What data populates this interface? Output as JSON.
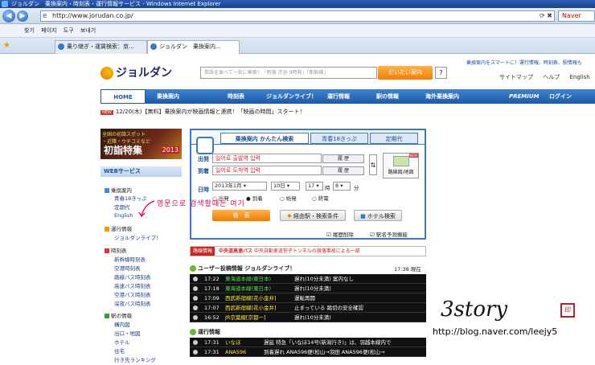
{
  "window": {
    "title": "ジョルダン　乗換案内・時刻表・運行情報サービス - Windows Internet Explorer"
  },
  "address": {
    "url": "http://www.jorudan.co.jp/",
    "search_text": "Naver"
  },
  "menubar": {
    "items": [
      "찾기",
      "페이지",
      "도구",
      "보내기"
    ]
  },
  "tabs": [
    {
      "label": "乗り継ぎ・運賃検索：京..."
    },
    {
      "label": "ジョルダン　乗換案内..."
    }
  ],
  "site": {
    "logo": "ジョルダン",
    "search_placeholder": "単語を並べて一気に検索！「新宿 渋谷 9時発」「新幹線」",
    "search_button": "だいたい案内",
    "help": "?",
    "tagline": "乗換案内をスマートに！運行情報、時刻表、駅情報も",
    "toplinks": [
      "サイトマップ",
      "ヘルプ",
      "English"
    ]
  },
  "nav": {
    "items": [
      "HOME",
      "乗換案内",
      "時刻表",
      "ジョルダンライブ！",
      "運行情報",
      "駅の情報",
      "海外乗換案内"
    ],
    "premium": "PREMIUM",
    "login": "ログイン"
  },
  "news": {
    "tag": "NEW",
    "text": "12/20(木)【無料】乗換案内が映画情報と連携！「映画の時間」スタート！"
  },
  "banner": {
    "line1": "全国の初詣スポット",
    "line2": "・近隣・ウチコミなど",
    "title": "初詣特集",
    "year": "2013"
  },
  "sidebar": {
    "header": "WEBサービス",
    "items": [
      "乗換案内",
      "青春18きっぷ",
      "定期代",
      "English",
      "運行情報",
      "ジョルダンライブ！",
      "時刻表",
      "新幹線時刻表",
      "空港時刻表",
      "路線バス時刻表",
      "高速バス時刻表",
      "空港バス時刻表",
      "深夜バス時刻表",
      "駅の情報",
      "構内図",
      "出口・地図",
      "ホテル",
      "住宅",
      "行き先ランキング"
    ]
  },
  "panel": {
    "tabs": [
      "乗換案内 かんたん検索",
      "青春18きっぷ",
      "定期代"
    ],
    "from_label": "出発",
    "to_label": "到着",
    "from_value": "일어로 출발역 입력",
    "to_value": "일어로 도착역 입력",
    "history": "履 歴",
    "map_button": "路線図/地図",
    "map_new": "NEW",
    "date_label": "日時",
    "month": "2013年1月",
    "day": "10日",
    "hour": "17",
    "hour_unit": "時",
    "minute": "8",
    "minute_unit": "分",
    "radios": [
      "出発",
      "到着",
      "始発",
      "終電"
    ],
    "search_button": "検　索",
    "via_button": "経由駅・検索条件",
    "hotel_button": "ホテル検索",
    "history_delete": "履歴削除",
    "station_predict": "駅名予測機能"
  },
  "annotation": "영문으로 검색할때는 여기",
  "info": {
    "tag": "路線情報",
    "title": "中央道高速バス",
    "text": "中央自動車道笹子トンネルの崩落事故による一部"
  },
  "live": {
    "title": "ユーザー投稿情報 ジョルダンライブ！",
    "time": "17:38 現在",
    "rows": [
      {
        "time": "17:22",
        "line": "東海道本線(東日本)",
        "text": "遅れ(10分未満) 案内なし"
      },
      {
        "time": "17:18",
        "line": "東海道本線(東日本)",
        "text": "遅れ(10分未満)"
      },
      {
        "time": "17:09",
        "line": "西武新宿線[花小金井]",
        "text": "運転再開"
      },
      {
        "time": "17:07",
        "line": "西武新宿線[花小金井]",
        "text": "止まっている 踏切の安全確認"
      },
      {
        "time": "16:52",
        "line": "JR京葉線[京都一]",
        "text": "遅れ(10分未満)"
      }
    ]
  },
  "operation": {
    "title": "運行情報",
    "rows": [
      {
        "time": "17:31",
        "line": "いなほ",
        "text": "遅延 特急「いなほ14号(新潟行き)」は、羽越本線内で"
      },
      {
        "time": "17:31",
        "line": "ANA596",
        "text": "到着遅れ ANA596便(松山→羽田 ANA596便(松山→"
      }
    ]
  },
  "watermark": {
    "signature": "3story",
    "url": "http://blog.naver.com/leejy5"
  }
}
